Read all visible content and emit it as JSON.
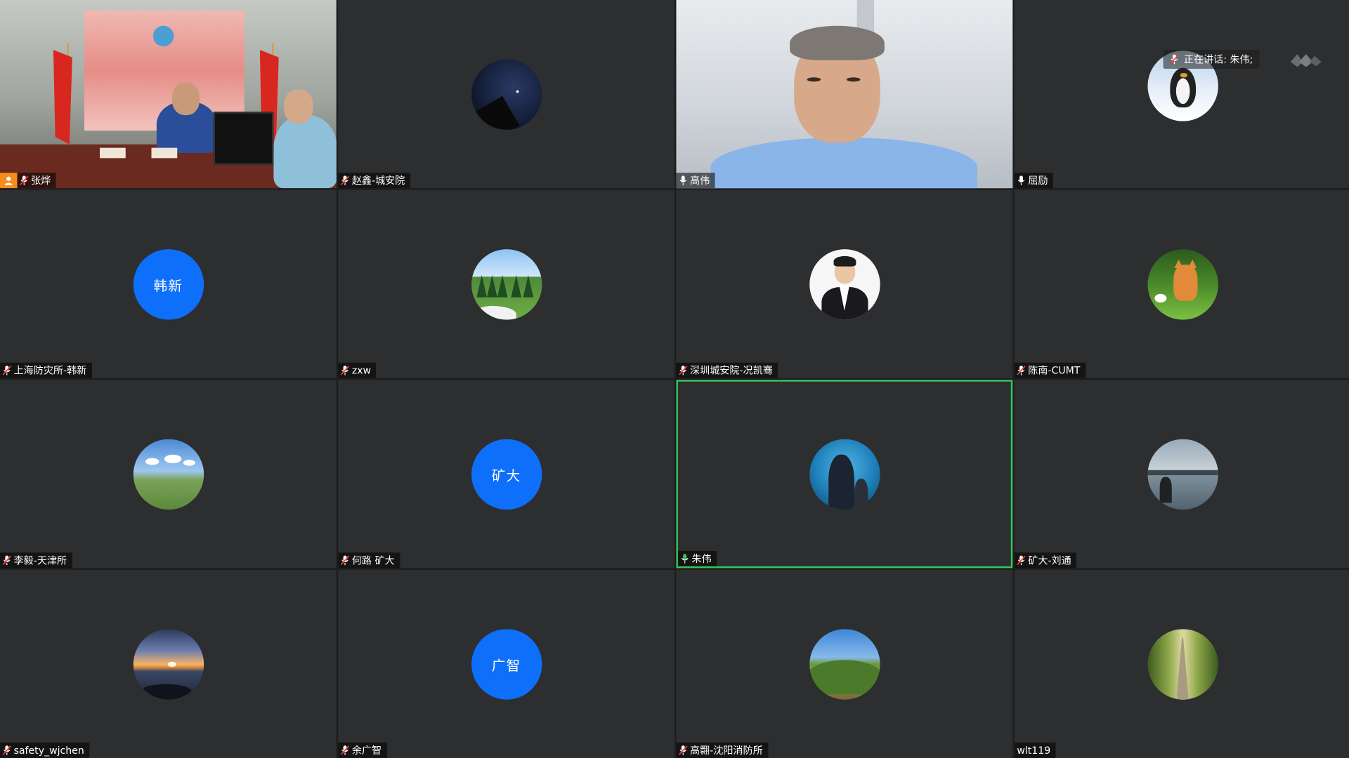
{
  "speaking_indicator": {
    "label": "正在讲话: 朱伟;",
    "icon": "mic-muted-icon"
  },
  "participants": [
    {
      "name": "张烨",
      "tile": "video-conference-room",
      "mic": "muted",
      "host": true
    },
    {
      "name": "赵鑫-城安院",
      "tile": "avatar",
      "avatar": "night-sky",
      "mic": "muted"
    },
    {
      "name": "高伟",
      "tile": "video-face",
      "mic": "active"
    },
    {
      "name": "屈励",
      "tile": "avatar",
      "avatar": "penguin",
      "mic": "active"
    },
    {
      "name": "上海防灾所-韩新",
      "tile": "initials",
      "initials": "韩新",
      "mic": "muted"
    },
    {
      "name": "zxw",
      "tile": "avatar",
      "avatar": "forest",
      "mic": "muted"
    },
    {
      "name": "深圳城安院-况凯骞",
      "tile": "avatar",
      "avatar": "portrait",
      "mic": "muted"
    },
    {
      "name": "陈南-CUMT",
      "tile": "avatar",
      "avatar": "cat",
      "mic": "muted"
    },
    {
      "name": "李毅-天津所",
      "tile": "avatar",
      "avatar": "meadow",
      "mic": "muted"
    },
    {
      "name": "何路 矿大",
      "tile": "initials",
      "initials": "矿大",
      "mic": "muted"
    },
    {
      "name": "朱伟",
      "tile": "avatar",
      "avatar": "aquarium",
      "mic": "speaking",
      "active": true
    },
    {
      "name": "矿大-刘通",
      "tile": "avatar",
      "avatar": "lake",
      "mic": "muted"
    },
    {
      "name": "safety_wjchen",
      "tile": "avatar",
      "avatar": "sunset",
      "mic": "muted"
    },
    {
      "name": "余广智",
      "tile": "initials",
      "initials": "广智",
      "mic": "muted"
    },
    {
      "name": "高翾-沈阳消防所",
      "tile": "avatar",
      "avatar": "valley",
      "mic": "muted"
    },
    {
      "name": "wlt119",
      "tile": "avatar",
      "avatar": "road",
      "mic": "none"
    }
  ],
  "colors": {
    "tile_bg": "#2d2e30",
    "initials_bg": "#0e6ffa",
    "active_border": "#34c759",
    "host_badge": "#f58c1e"
  }
}
